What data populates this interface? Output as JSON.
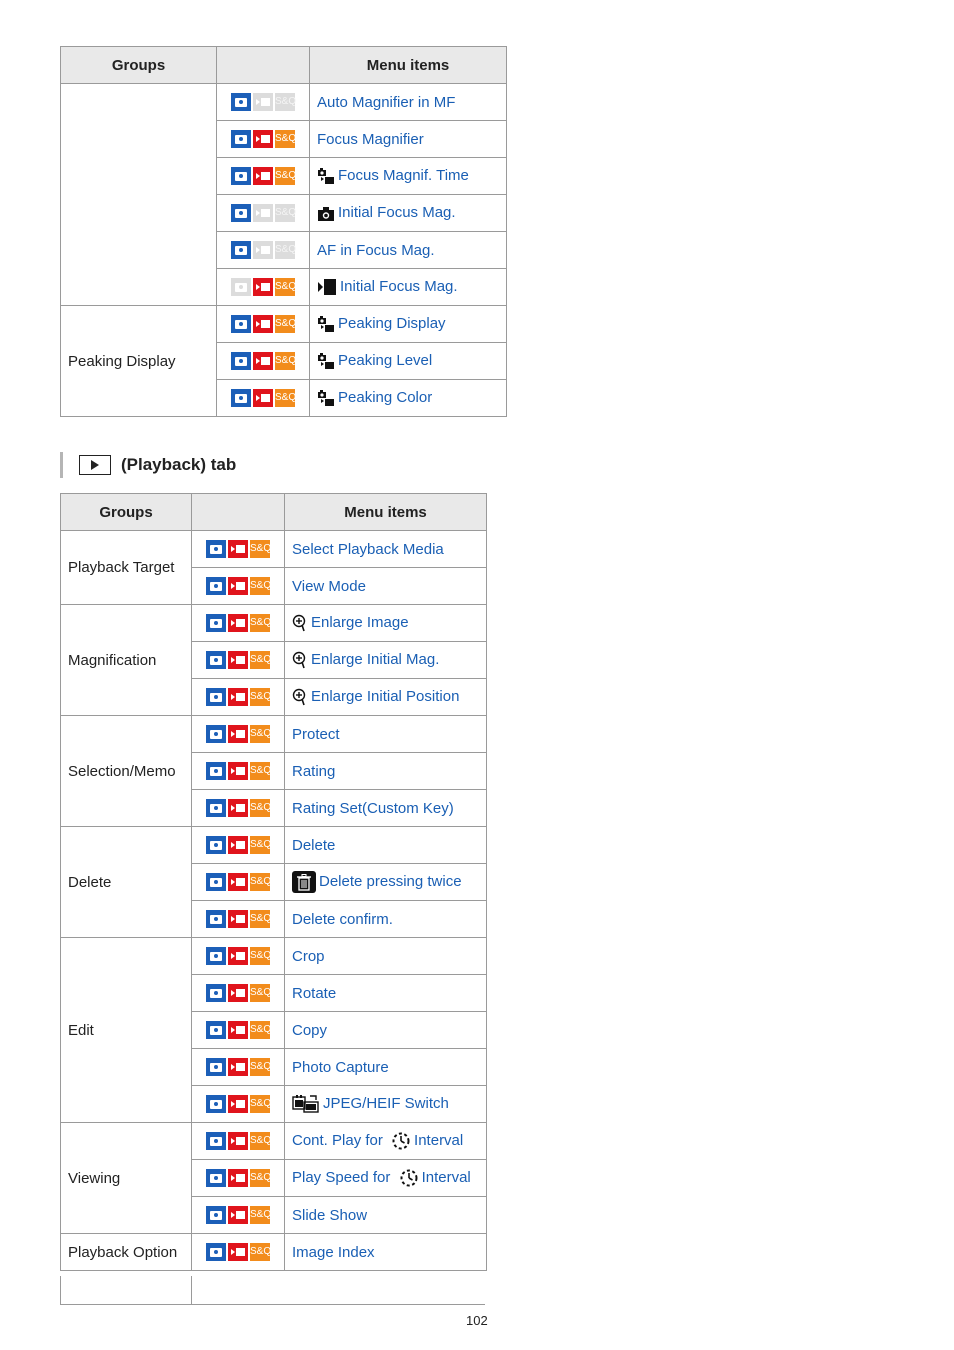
{
  "table1": {
    "headers": {
      "groups": "Groups",
      "menu_items": "Menu items"
    },
    "rows": [
      {
        "group": "",
        "modes": [
          "on",
          "off",
          "off"
        ],
        "icon": "",
        "label": "Auto Magnifier in MF"
      },
      {
        "group": "",
        "modes": [
          "on",
          "on",
          "on"
        ],
        "icon": "",
        "label": "Focus Magnifier"
      },
      {
        "group": "",
        "modes": [
          "on",
          "on",
          "on"
        ],
        "icon": "photo-movie-icon",
        "label": "Focus Magnif. Time"
      },
      {
        "group": "",
        "modes": [
          "on",
          "off",
          "off"
        ],
        "icon": "camera-icon",
        "label": "Initial Focus Mag."
      },
      {
        "group": "",
        "modes": [
          "on",
          "off",
          "off"
        ],
        "icon": "",
        "label": "AF in Focus Mag."
      },
      {
        "group": "",
        "modes": [
          "off",
          "on",
          "on"
        ],
        "icon": "movie-icon",
        "label": "Initial Focus Mag."
      },
      {
        "group": "Peaking Display",
        "modes": [
          "on",
          "on",
          "on"
        ],
        "icon": "photo-movie-icon",
        "label": "Peaking Display"
      },
      {
        "group": "",
        "modes": [
          "on",
          "on",
          "on"
        ],
        "icon": "photo-movie-icon",
        "label": "Peaking Level"
      },
      {
        "group": "",
        "modes": [
          "on",
          "on",
          "on"
        ],
        "icon": "photo-movie-icon",
        "label": "Peaking Color"
      }
    ]
  },
  "section": {
    "title": "(Playback) tab",
    "icon": "playback-icon"
  },
  "table2": {
    "headers": {
      "groups": "Groups",
      "menu_items": "Menu items"
    },
    "groups": [
      {
        "name": "Playback Target",
        "items": [
          {
            "icon": "",
            "label": "Select Playback Media"
          },
          {
            "icon": "",
            "label": "View Mode"
          }
        ]
      },
      {
        "name": "Magnification",
        "items": [
          {
            "icon": "zoom-icon",
            "label": "Enlarge Image"
          },
          {
            "icon": "zoom-icon",
            "label": "Enlarge Initial Mag."
          },
          {
            "icon": "zoom-icon",
            "label": "Enlarge Initial Position"
          }
        ]
      },
      {
        "name": "Selection/Memo",
        "items": [
          {
            "icon": "",
            "label": "Protect"
          },
          {
            "icon": "",
            "label": "Rating"
          },
          {
            "icon": "",
            "label": "Rating Set(Custom Key)"
          }
        ]
      },
      {
        "name": "Delete",
        "items": [
          {
            "icon": "",
            "label": "Delete"
          },
          {
            "icon": "trash-icon",
            "label": "Delete pressing twice"
          },
          {
            "icon": "",
            "label": "Delete confirm."
          }
        ]
      },
      {
        "name": "Edit",
        "items": [
          {
            "icon": "",
            "label": "Crop"
          },
          {
            "icon": "",
            "label": "Rotate"
          },
          {
            "icon": "",
            "label": "Copy"
          },
          {
            "icon": "",
            "label": "Photo Capture"
          },
          {
            "icon": "jpeg-heif-icon",
            "label": "JPEG/HEIF Switch"
          }
        ]
      },
      {
        "name": "Viewing",
        "items": [
          {
            "icon": "",
            "label_pre": "Cont. Play for",
            "icon2": "interval-icon",
            "label": "Interval"
          },
          {
            "icon": "",
            "label_pre": "Play Speed for",
            "icon2": "interval-icon",
            "label": "Interval"
          },
          {
            "icon": "",
            "label": "Slide Show"
          }
        ]
      },
      {
        "name": "Playback Option",
        "items": [
          {
            "icon": "",
            "label": "Image Index"
          }
        ]
      }
    ]
  },
  "mode_labels": {
    "sq": "S&Q"
  },
  "colors": {
    "photo": "#1c5fb8",
    "movie": "#e0141c",
    "sq": "#f28c1c",
    "link": "#1a5fb4"
  },
  "page_number": "102"
}
